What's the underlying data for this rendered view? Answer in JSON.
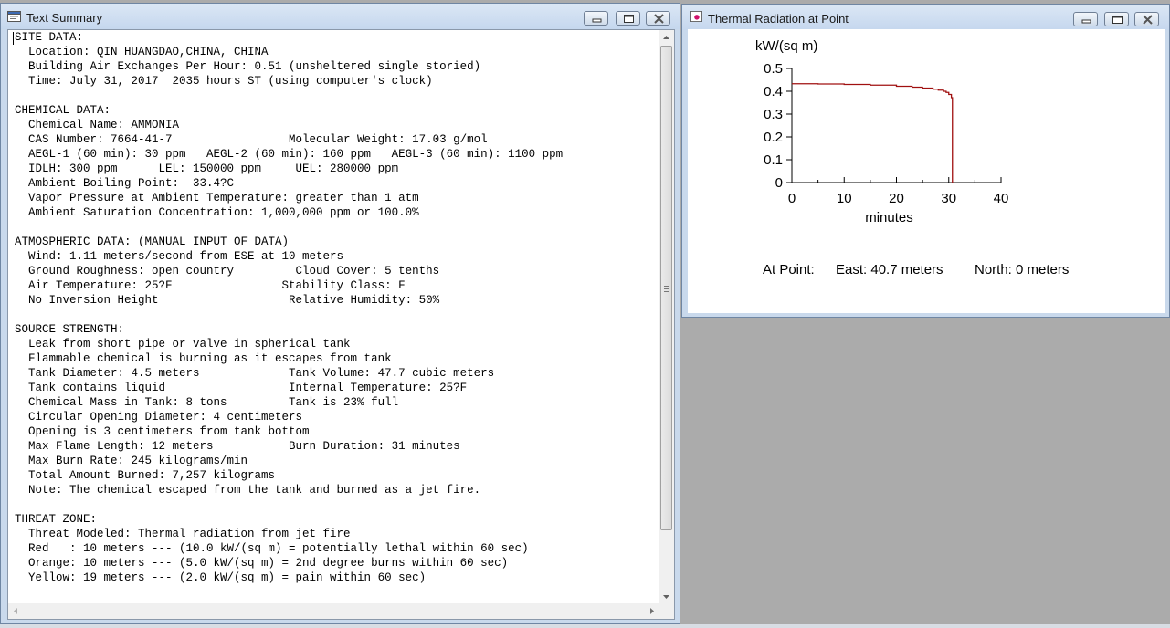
{
  "left_window": {
    "title": "Text Summary",
    "lines": [
      "SITE DATA:",
      "  Location: QIN HUANGDAO,CHINA, CHINA",
      "  Building Air Exchanges Per Hour: 0.51 (unsheltered single storied)",
      "  Time: July 31, 2017  2035 hours ST (using computer's clock)",
      "",
      "CHEMICAL DATA:",
      "  Chemical Name: AMMONIA",
      "  CAS Number: 7664-41-7                 Molecular Weight: 17.03 g/mol",
      "  AEGL-1 (60 min): 30 ppm   AEGL-2 (60 min): 160 ppm   AEGL-3 (60 min): 1100 ppm",
      "  IDLH: 300 ppm      LEL: 150000 ppm     UEL: 280000 ppm",
      "  Ambient Boiling Point: -33.4?C",
      "  Vapor Pressure at Ambient Temperature: greater than 1 atm",
      "  Ambient Saturation Concentration: 1,000,000 ppm or 100.0%",
      "",
      "ATMOSPHERIC DATA: (MANUAL INPUT OF DATA)",
      "  Wind: 1.11 meters/second from ESE at 10 meters",
      "  Ground Roughness: open country         Cloud Cover: 5 tenths",
      "  Air Temperature: 25?F                Stability Class: F",
      "  No Inversion Height                   Relative Humidity: 50%",
      "",
      "SOURCE STRENGTH:",
      "  Leak from short pipe or valve in spherical tank",
      "  Flammable chemical is burning as it escapes from tank",
      "  Tank Diameter: 4.5 meters             Tank Volume: 47.7 cubic meters",
      "  Tank contains liquid                  Internal Temperature: 25?F",
      "  Chemical Mass in Tank: 8 tons         Tank is 23% full",
      "  Circular Opening Diameter: 4 centimeters",
      "  Opening is 3 centimeters from tank bottom",
      "  Max Flame Length: 12 meters           Burn Duration: 31 minutes",
      "  Max Burn Rate: 245 kilograms/min",
      "  Total Amount Burned: 7,257 kilograms",
      "  Note: The chemical escaped from the tank and burned as a jet fire.",
      "",
      "THREAT ZONE:",
      "  Threat Modeled: Thermal radiation from jet fire",
      "  Red   : 10 meters --- (10.0 kW/(sq m) = potentially lethal within 60 sec)",
      "  Orange: 10 meters --- (5.0 kW/(sq m) = 2nd degree burns within 60 sec)",
      "  Yellow: 19 meters --- (2.0 kW/(sq m) = pain within 60 sec)"
    ]
  },
  "right_window": {
    "title": "Thermal Radiation at Point",
    "footer": {
      "label": "At Point:",
      "east": "East: 40.7 meters",
      "north": "North: 0 meters"
    }
  },
  "chart_data": {
    "type": "line",
    "ylabel": "kW/(sq m)",
    "xlabel": "minutes",
    "xlim": [
      0,
      40
    ],
    "ylim": [
      0,
      0.5
    ],
    "xticks": [
      "0",
      "10",
      "20",
      "30",
      "40"
    ],
    "yticks": [
      "0",
      "0.1",
      "0.2",
      "0.3",
      "0.4",
      "0.5"
    ],
    "grid": false,
    "line_color": "#a01010",
    "series": [
      {
        "x": [
          0,
          5,
          10,
          15,
          20,
          23,
          25,
          27,
          28,
          29,
          29.5,
          30,
          30.5,
          30.7,
          30.7
        ],
        "y": [
          0.433,
          0.432,
          0.43,
          0.427,
          0.422,
          0.418,
          0.414,
          0.409,
          0.405,
          0.4,
          0.395,
          0.386,
          0.372,
          0.36,
          0
        ]
      }
    ]
  }
}
